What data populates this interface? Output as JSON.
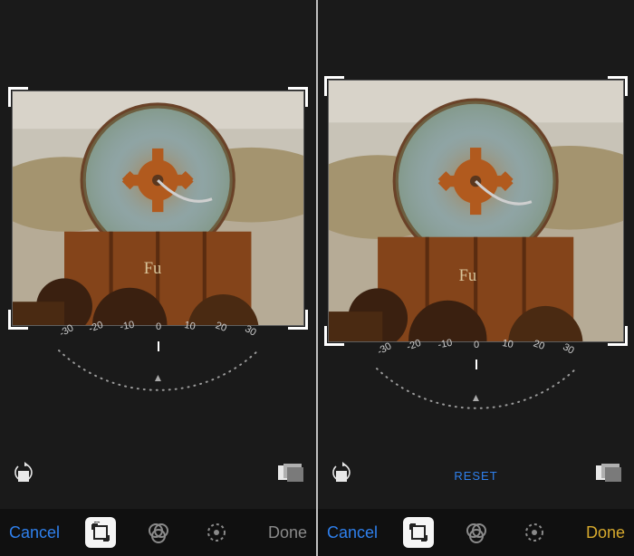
{
  "left": {
    "cancel_label": "Cancel",
    "done_label": "Done",
    "done_style": "gray",
    "reset_visible": false,
    "dial_ticks": [
      "-30",
      "-20",
      "-10",
      "0",
      "10",
      "20",
      "30"
    ],
    "dial_value": 0
  },
  "right": {
    "cancel_label": "Cancel",
    "done_label": "Done",
    "done_style": "gold",
    "reset_label": "RESET",
    "reset_visible": true,
    "dial_ticks": [
      "-30",
      "-20",
      "-10",
      "0",
      "10",
      "20",
      "30"
    ],
    "dial_value": 0
  },
  "icons": {
    "rotate": "rotate-icon",
    "aspect": "aspect-icon",
    "crop_tool": "crop-rotate-icon",
    "filters": "filters-icon",
    "adjust": "adjust-icon"
  },
  "colors": {
    "accent_blue": "#2f80ed",
    "accent_gold": "#d6a92d",
    "panel_bg": "#1a1a1a"
  }
}
